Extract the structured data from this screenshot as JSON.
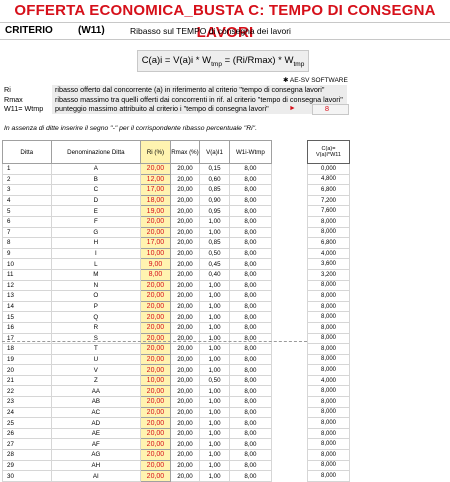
{
  "title": "OFFERTA ECONOMICA_BUSTA C: TEMPO  DI CONSEGNA LAVORI",
  "criterio": {
    "label": "CRITERIO",
    "code": "(W11)",
    "description": "Ribasso sul TEMPO di consegna dei lavori"
  },
  "formula": {
    "part1": "C(a)i = V(a)i * W",
    "sub1": "tmp",
    "part2": " = (Ri/Rmax) * W",
    "sub2": "tmp"
  },
  "software": "AE-SV SOFTWARE",
  "definitions": [
    {
      "key": "Ri",
      "text": "ribasso offerto dal concorrente (a) in riferimento al criterio \"tempo di consegna lavori\""
    },
    {
      "key": "Rmax",
      "text": "ribasso massimo tra quelli offerti dai concorrenti in rif. al criterio \"tempo di consegna lavori\""
    },
    {
      "key": "W11= Wtmp",
      "text": "punteggio massimo attribuito  al criterio i \"tempo di consegna lavori\""
    }
  ],
  "weight_value": "8",
  "note": "In assenza di ditte inserire il segno \"-\" per il corrispondente ribasso percentuale \"Ri\".",
  "table": {
    "headers": [
      "Ditta",
      "Denominazione Ditta",
      "Ri (%)",
      "Rmax (%)",
      "V(a)I1",
      "W1i-Wtmp"
    ],
    "score_header": "C(a)=\nV(a)I*W11",
    "rows": [
      {
        "n": "1",
        "name": "A",
        "ri": "20,00",
        "rmax": "20,00",
        "v": "0,15",
        "w": "8,00",
        "c": "0,000"
      },
      {
        "n": "2",
        "name": "B",
        "ri": "12,00",
        "rmax": "20,00",
        "v": "0,60",
        "w": "8,00",
        "c": "4,800"
      },
      {
        "n": "3",
        "name": "C",
        "ri": "17,00",
        "rmax": "20,00",
        "v": "0,85",
        "w": "8,00",
        "c": "6,800"
      },
      {
        "n": "4",
        "name": "D",
        "ri": "18,00",
        "rmax": "20,00",
        "v": "0,90",
        "w": "8,00",
        "c": "7,200"
      },
      {
        "n": "5",
        "name": "E",
        "ri": "19,00",
        "rmax": "20,00",
        "v": "0,95",
        "w": "8,00",
        "c": "7,600"
      },
      {
        "n": "6",
        "name": "F",
        "ri": "20,00",
        "rmax": "20,00",
        "v": "1,00",
        "w": "8,00",
        "c": "8,000"
      },
      {
        "n": "7",
        "name": "G",
        "ri": "20,00",
        "rmax": "20,00",
        "v": "1,00",
        "w": "8,00",
        "c": "8,000"
      },
      {
        "n": "8",
        "name": "H",
        "ri": "17,00",
        "rmax": "20,00",
        "v": "0,85",
        "w": "8,00",
        "c": "6,800"
      },
      {
        "n": "9",
        "name": "I",
        "ri": "10,00",
        "rmax": "20,00",
        "v": "0,50",
        "w": "8,00",
        "c": "4,000"
      },
      {
        "n": "10",
        "name": "L",
        "ri": "9,00",
        "rmax": "20,00",
        "v": "0,45",
        "w": "8,00",
        "c": "3,600"
      },
      {
        "n": "11",
        "name": "M",
        "ri": "8,00",
        "rmax": "20,00",
        "v": "0,40",
        "w": "8,00",
        "c": "3,200"
      },
      {
        "n": "12",
        "name": "N",
        "ri": "20,00",
        "rmax": "20,00",
        "v": "1,00",
        "w": "8,00",
        "c": "8,000"
      },
      {
        "n": "13",
        "name": "O",
        "ri": "20,00",
        "rmax": "20,00",
        "v": "1,00",
        "w": "8,00",
        "c": "8,000"
      },
      {
        "n": "14",
        "name": "P",
        "ri": "20,00",
        "rmax": "20,00",
        "v": "1,00",
        "w": "8,00",
        "c": "8,000"
      },
      {
        "n": "15",
        "name": "Q",
        "ri": "20,00",
        "rmax": "20,00",
        "v": "1,00",
        "w": "8,00",
        "c": "8,000"
      },
      {
        "n": "16",
        "name": "R",
        "ri": "20,00",
        "rmax": "20,00",
        "v": "1,00",
        "w": "8,00",
        "c": "8,000"
      },
      {
        "n": "17",
        "name": "S",
        "ri": "20,00",
        "rmax": "20,00",
        "v": "1,00",
        "w": "8,00",
        "c": "8,000"
      },
      {
        "n": "18",
        "name": "T",
        "ri": "20,00",
        "rmax": "20,00",
        "v": "1,00",
        "w": "8,00",
        "c": "8,000"
      },
      {
        "n": "19",
        "name": "U",
        "ri": "20,00",
        "rmax": "20,00",
        "v": "1,00",
        "w": "8,00",
        "c": "8,000"
      },
      {
        "n": "20",
        "name": "V",
        "ri": "20,00",
        "rmax": "20,00",
        "v": "1,00",
        "w": "8,00",
        "c": "8,000"
      },
      {
        "n": "21",
        "name": "Z",
        "ri": "10,00",
        "rmax": "20,00",
        "v": "0,50",
        "w": "8,00",
        "c": "4,000"
      },
      {
        "n": "22",
        "name": "AA",
        "ri": "20,00",
        "rmax": "20,00",
        "v": "1,00",
        "w": "8,00",
        "c": "8,000"
      },
      {
        "n": "23",
        "name": "AB",
        "ri": "20,00",
        "rmax": "20,00",
        "v": "1,00",
        "w": "8,00",
        "c": "8,000"
      },
      {
        "n": "24",
        "name": "AC",
        "ri": "20,00",
        "rmax": "20,00",
        "v": "1,00",
        "w": "8,00",
        "c": "8,000"
      },
      {
        "n": "25",
        "name": "AD",
        "ri": "20,00",
        "rmax": "20,00",
        "v": "1,00",
        "w": "8,00",
        "c": "8,000"
      },
      {
        "n": "26",
        "name": "AE",
        "ri": "20,00",
        "rmax": "20,00",
        "v": "1,00",
        "w": "8,00",
        "c": "8,000"
      },
      {
        "n": "27",
        "name": "AF",
        "ri": "20,00",
        "rmax": "20,00",
        "v": "1,00",
        "w": "8,00",
        "c": "8,000"
      },
      {
        "n": "28",
        "name": "AG",
        "ri": "20,00",
        "rmax": "20,00",
        "v": "1,00",
        "w": "8,00",
        "c": "8,000"
      },
      {
        "n": "29",
        "name": "AH",
        "ri": "20,00",
        "rmax": "20,00",
        "v": "1,00",
        "w": "8,00",
        "c": "8,000"
      },
      {
        "n": "30",
        "name": "AI",
        "ri": "20,00",
        "rmax": "20,00",
        "v": "1,00",
        "w": "8,00",
        "c": "8,000"
      }
    ]
  },
  "colors": {
    "title": "#d6101a",
    "ri_fill": "#fff3b0",
    "ri_text": "#d6101a"
  }
}
